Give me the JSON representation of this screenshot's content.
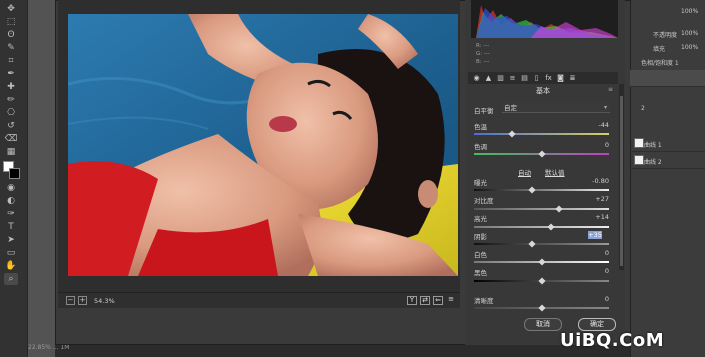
{
  "app": {
    "zoom": "54.3%",
    "status_text": "22.85%  ...  1M"
  },
  "toolbar": {
    "tools": [
      "move-icon",
      "marquee-icon",
      "lasso-icon",
      "quick-select-icon",
      "crop-icon",
      "eyedropper-icon",
      "healing-icon",
      "brush-icon",
      "stamp-icon",
      "history-brush-icon",
      "eraser-icon",
      "gradient-icon",
      "blur-icon",
      "dodge-icon",
      "pen-icon",
      "type-icon",
      "path-select-icon",
      "shape-icon",
      "hand-icon",
      "zoom-icon"
    ],
    "glyphs": [
      "✥",
      "⬚",
      "ʘ",
      "✎",
      "⌗",
      "✒",
      "✚",
      "✏",
      "⎔",
      "↺",
      "⌫",
      "▦",
      "◉",
      "◐",
      "✑",
      "T",
      "➤",
      "▭",
      "✋",
      "⌕"
    ],
    "foreground_color": "#ffffff",
    "background_color": "#000000"
  },
  "histogram": {
    "info": [
      "R: ---",
      "G: ---",
      "B: ---"
    ]
  },
  "panel": {
    "title": "基本",
    "white_balance_label": "白平衡",
    "white_balance_value": "自定",
    "auto_label": "自动",
    "default_label": "默认值",
    "tabs": [
      "basic-tab-icon",
      "tone-curve-tab-icon",
      "detail-tab-icon",
      "hsl-tab-icon",
      "split-tone-tab-icon",
      "lens-tab-icon",
      "fx-tab-icon",
      "camera-cal-tab-icon",
      "presets-tab-icon"
    ],
    "tab_glyphs": [
      "◉",
      "▲",
      "▥",
      "≡",
      "▤",
      "▯",
      "fx",
      "◙",
      "≣"
    ],
    "sliders": [
      {
        "id": "temperature",
        "label": "色温",
        "value": "-44",
        "position": 0.28
      },
      {
        "id": "tint",
        "label": "色调",
        "value": "0",
        "position": 0.5
      },
      {
        "id": "exposure",
        "label": "曝光",
        "value": "-0.80",
        "position": 0.43
      },
      {
        "id": "contrast",
        "label": "对比度",
        "value": "+27",
        "position": 0.63
      },
      {
        "id": "highlights",
        "label": "高光",
        "value": "+14",
        "position": 0.57
      },
      {
        "id": "shadows",
        "label": "阴影",
        "value": "+35",
        "position": 0.43
      },
      {
        "id": "whites",
        "label": "白色",
        "value": "0",
        "position": 0.5
      },
      {
        "id": "blacks",
        "label": "黑色",
        "value": "0",
        "position": 0.5
      },
      {
        "id": "clarity",
        "label": "清晰度",
        "value": "0",
        "position": 0.5
      }
    ]
  },
  "buttons": {
    "cancel": "取消",
    "ok": "确定"
  },
  "layers": {
    "opacity_label": "不透明度",
    "opacity_value": "100%",
    "fill_label": "填充",
    "fill_value": "100%",
    "hue_sat_label": "色相/饱和度 1",
    "row_labels": [
      "曲线 1",
      "曲线 2"
    ],
    "extra_value": "100%",
    "short_label": "2"
  },
  "watermark": "UiBQ.CoM"
}
